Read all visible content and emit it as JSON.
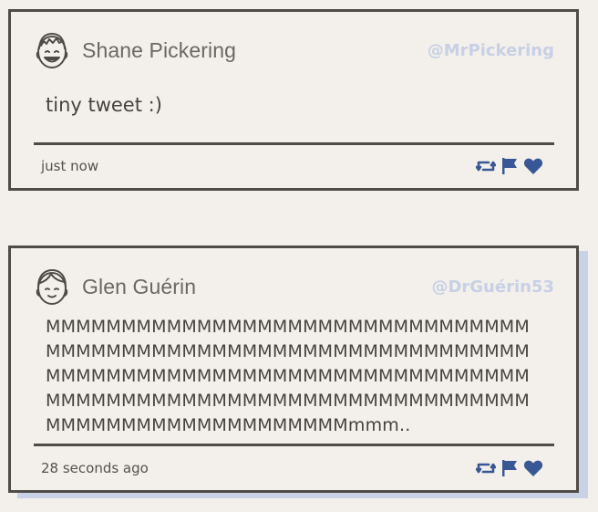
{
  "colors": {
    "background": "#f3f0eb",
    "border": "#4f4c47",
    "handle": "#c8d0e6",
    "icon_blue": "#3a5795",
    "shadow": "#c9d1e6"
  },
  "tweets": [
    {
      "name": "Shane Pickering",
      "handle": "@MrPickering",
      "content": "tiny tweet :)",
      "time": "just now",
      "avatar_icon": "smiling-face-avatar-icon",
      "actions": [
        "retweet-icon",
        "flag-icon",
        "heart-icon"
      ]
    },
    {
      "name": "Glen Guérin",
      "handle": "@DrGuérin53",
      "content": "MMMMMMMMMMMMMMMMMMMMMMMMMMMMMMMMMMMMMMMMMMMMMMMMMMMMMMMMMMMMMMMMMMMMMMMMMMMMMMMMMMMMMMMMMMMMMMMMMMMMMMMMMMMMMMMMMMMMMMMMMMMMMMMMMMMMMMMMMMMMMMMMMMMMmmm..",
      "time": "28 seconds ago",
      "avatar_icon": "face-avatar-icon",
      "actions": [
        "retweet-icon",
        "flag-icon",
        "heart-icon"
      ]
    }
  ]
}
